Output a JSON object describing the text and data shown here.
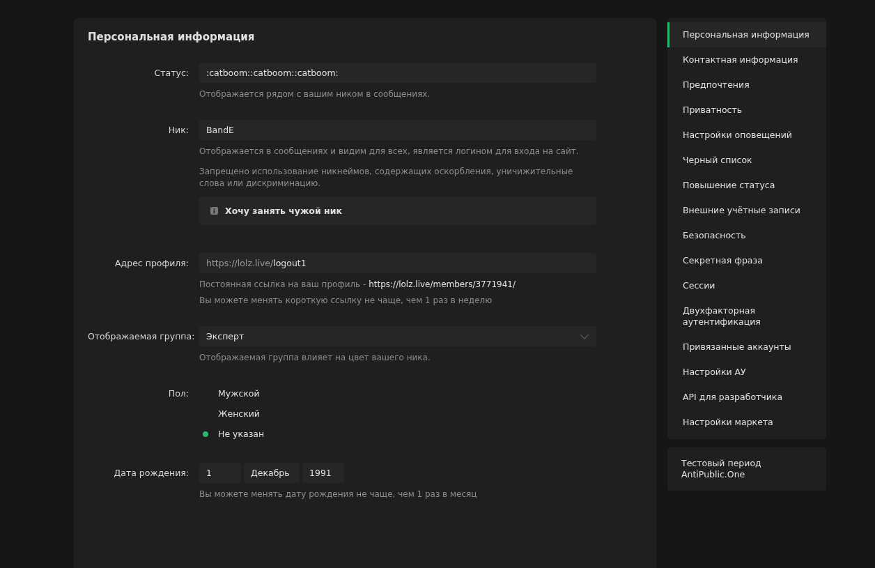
{
  "panel": {
    "title": "Персональная информация"
  },
  "fields": [
    {
      "kind": "text",
      "label": "Статус:",
      "value": ":catboom::catboom::catboom:",
      "hints": [
        {
          "text": "Отображается рядом с вашим ником в сообщениях."
        }
      ]
    },
    {
      "kind": "text",
      "label": "Ник:",
      "value": "BandE",
      "hints": [
        {
          "text": "Отображается в сообщениях и видим для всех, является логином для входа на сайт."
        },
        {
          "text": "Запрещено использование никнеймов, содержащих оскорбления, уничижительные слова или дискриминацию."
        }
      ],
      "action": "Хочу занять чужой ник"
    },
    {
      "kind": "address",
      "label": "Адрес профиля:",
      "prefix": "https://lolz.live/",
      "value": "logout1",
      "hints": [
        {
          "text": "Постоянная ссылка на ваш профиль - ",
          "link": "https://lolz.live/members/3771941/"
        },
        {
          "text": "Вы можете менять короткую ссылку не чаще, чем 1 раз в неделю"
        }
      ]
    },
    {
      "kind": "select",
      "label": "Отображаемая группа:",
      "value": "Эксперт",
      "hints": [
        {
          "text": "Отображаемая группа влияет на цвет вашего ника."
        }
      ]
    },
    {
      "kind": "radio",
      "label": "Пол:",
      "options": [
        {
          "label": "Мужской",
          "selected": false
        },
        {
          "label": "Женский",
          "selected": false
        },
        {
          "label": "Не указан",
          "selected": true
        }
      ]
    },
    {
      "kind": "date",
      "label": "Дата рождения:",
      "day": "1",
      "month": "Декабрь",
      "year": "1991",
      "hints": [
        {
          "text": "Вы можете менять дату рождения не чаще, чем 1 раз в месяц"
        }
      ]
    }
  ],
  "sidebar": {
    "items": [
      {
        "label": "Персональная информация",
        "selected": true
      },
      {
        "label": "Контактная информация",
        "selected": false
      },
      {
        "label": "Предпочтения",
        "selected": false
      },
      {
        "label": "Приватность",
        "selected": false
      },
      {
        "label": "Настройки оповещений",
        "selected": false
      },
      {
        "label": "Черный список",
        "selected": false
      },
      {
        "label": "Повышение статуса",
        "selected": false
      },
      {
        "label": "Внешние учётные записи",
        "selected": false
      },
      {
        "label": "Безопасность",
        "selected": false
      },
      {
        "label": "Секретная фраза",
        "selected": false
      },
      {
        "label": "Сессии",
        "selected": false
      },
      {
        "label": "Двухфакторная аутентификация",
        "selected": false
      },
      {
        "label": "Привязанные аккаунты",
        "selected": false
      },
      {
        "label": "Настройки АУ",
        "selected": false
      },
      {
        "label": "API для разработчика",
        "selected": false
      },
      {
        "label": "Настройки маркета",
        "selected": false
      }
    ],
    "extra": "Тестовый период AntiPublic.One"
  }
}
